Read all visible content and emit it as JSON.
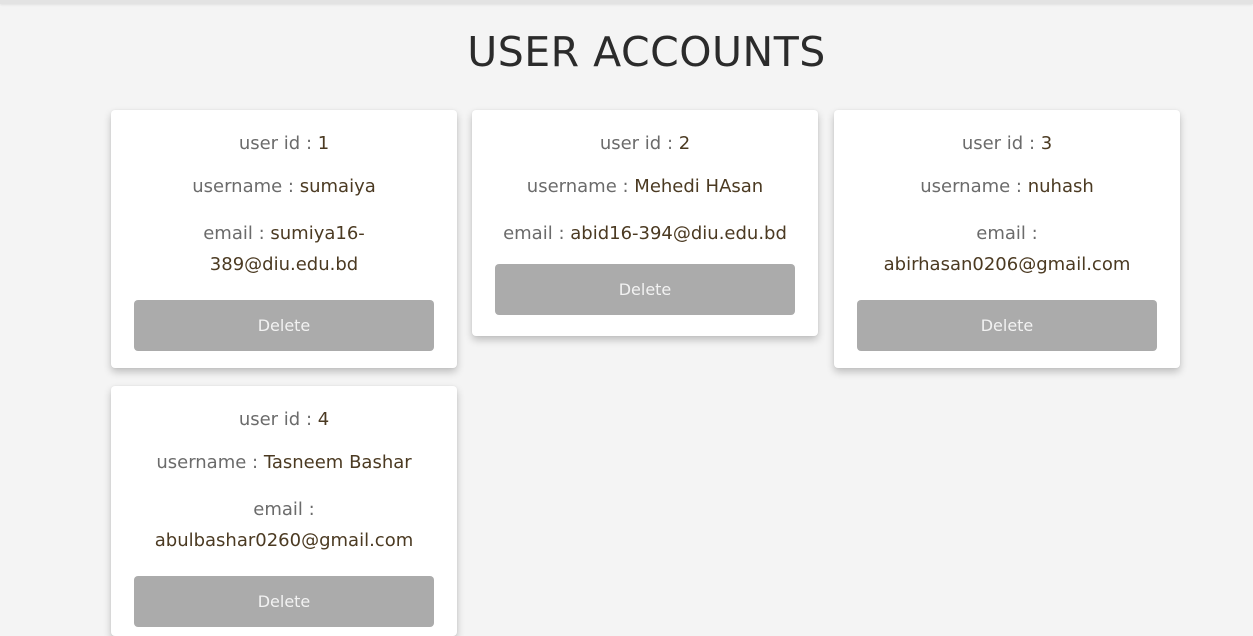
{
  "page": {
    "title": "USER ACCOUNTS"
  },
  "labels": {
    "user_id": "user id : ",
    "username": "username : ",
    "email": "email : "
  },
  "users": [
    {
      "id": "1",
      "username": "sumaiya",
      "email_line1": "sumiya16-",
      "email_line2": "389@diu.edu.bd",
      "delete_label": "Delete"
    },
    {
      "id": "2",
      "username": "Mehedi HAsan",
      "email_line1": "abid16-394@diu.edu.bd",
      "email_line2": "",
      "delete_label": "Delete"
    },
    {
      "id": "3",
      "username": "nuhash",
      "email_line1": "",
      "email_line2": "abirhasan0206@gmail.com",
      "delete_label": "Delete"
    },
    {
      "id": "4",
      "username": "Tasneem Bashar",
      "email_line1": "",
      "email_line2": "abulbashar0260@gmail.com",
      "delete_label": "Delete"
    }
  ],
  "colors": {
    "button": "#ababab",
    "background": "#f4f4f4",
    "value_text": "#4b3a22",
    "label_text": "#6b6b6b"
  }
}
